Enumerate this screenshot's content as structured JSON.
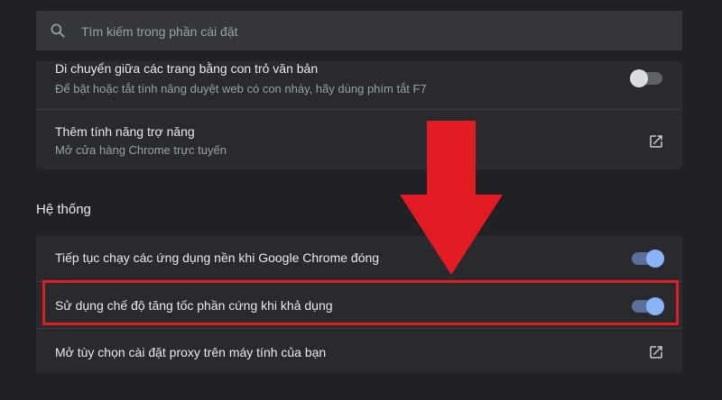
{
  "search": {
    "placeholder": "Tìm kiếm trong phần cài đặt",
    "value": ""
  },
  "accessibility": {
    "caret_browsing": {
      "title": "Di chuyển giữa các trang bằng con trỏ văn bản",
      "description": "Để bật hoặc tắt tính năng duyệt web có con nháy, hãy dùng phím tắt F7",
      "enabled": false
    },
    "add_features": {
      "title": "Thêm tính năng trợ năng",
      "description": "Mở cửa hàng Chrome trực tuyến",
      "icon": "open-in-new-icon"
    }
  },
  "system": {
    "section_title": "Hệ thống",
    "background_apps": {
      "title": "Tiếp tục chạy các ứng dụng nền khi Google Chrome đóng",
      "enabled": true
    },
    "hardware_acceleration": {
      "title": "Sử dụng chế độ tăng tốc phần cứng khi khả dụng",
      "enabled": true
    },
    "proxy": {
      "title": "Mở tùy chọn cài đặt proxy trên máy tính của bạn",
      "icon": "open-in-new-icon"
    }
  },
  "colors": {
    "annotation": "#e31c23",
    "toggle_on": "#8ab4f8",
    "background": "#202124",
    "card": "#292a2d"
  }
}
